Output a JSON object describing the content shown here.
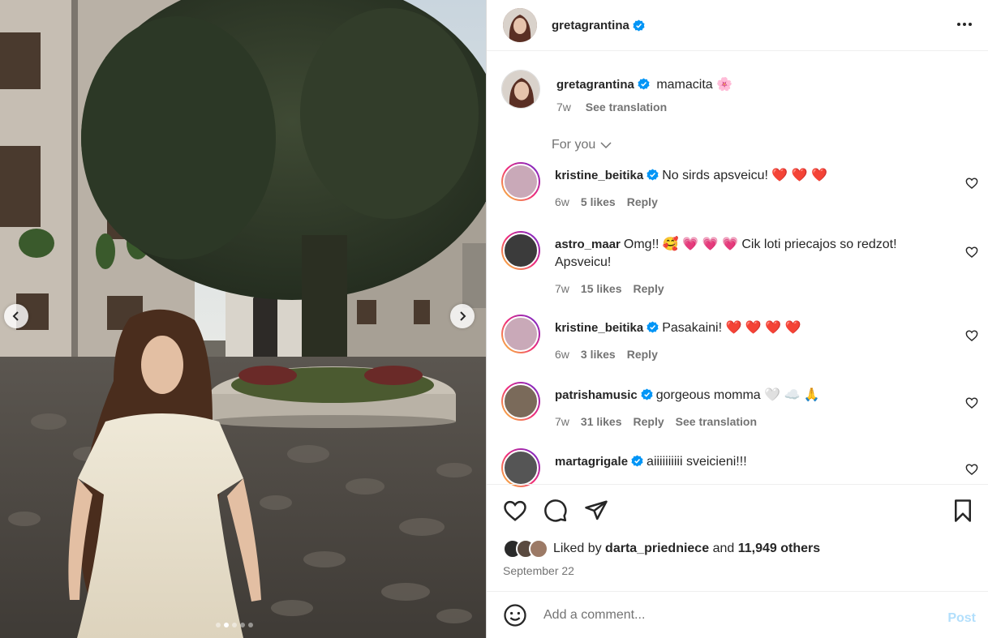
{
  "post": {
    "author": "gretagrantina",
    "verified": true,
    "caption_text": "mamacita 🌸",
    "caption_age": "7w",
    "see_translation": "See translation",
    "more_icon": "more-horizontal-icon"
  },
  "carousel": {
    "prev_icon": "chevron-left-icon",
    "next_icon": "chevron-right-icon",
    "dot_count": 5,
    "active_dot": 2
  },
  "section_label": "For you",
  "comments": [
    {
      "user": "kristine_beitika",
      "verified": true,
      "text": "No sirds apsveicu! ❤️ ❤️ ❤️",
      "age": "6w",
      "likes": "5 likes",
      "reply": "Reply",
      "translate": ""
    },
    {
      "user": "astro_maar",
      "verified": false,
      "text": "Omg!! 🥰 💗 💗 💗  Cik loti priecajos so redzot! Apsveicu!",
      "age": "7w",
      "likes": "15 likes",
      "reply": "Reply",
      "translate": ""
    },
    {
      "user": "kristine_beitika",
      "verified": true,
      "text": "Pasakaini! ❤️ ❤️ ❤️ ❤️",
      "age": "6w",
      "likes": "3 likes",
      "reply": "Reply",
      "translate": ""
    },
    {
      "user": "patrishamusic",
      "verified": true,
      "text": "gorgeous momma 🤍 ☁️ 🙏",
      "age": "7w",
      "likes": "31 likes",
      "reply": "Reply",
      "translate": "See translation"
    },
    {
      "user": "martagrigale",
      "verified": true,
      "text": "aiiiiiiiiii sveicieni!!!",
      "age": "",
      "likes": "",
      "reply": "",
      "translate": ""
    }
  ],
  "likes": {
    "prefix": "Liked by",
    "user": "darta_priedniece",
    "and": "and",
    "others": "11,949 others"
  },
  "date": "September 22",
  "composer": {
    "placeholder": "Add a comment...",
    "post_label": "Post",
    "emoji_icon": "emoji-icon"
  },
  "colors": {
    "verified": "#0095f6",
    "post_disabled": "#b2dffc",
    "muted": "#737373"
  }
}
